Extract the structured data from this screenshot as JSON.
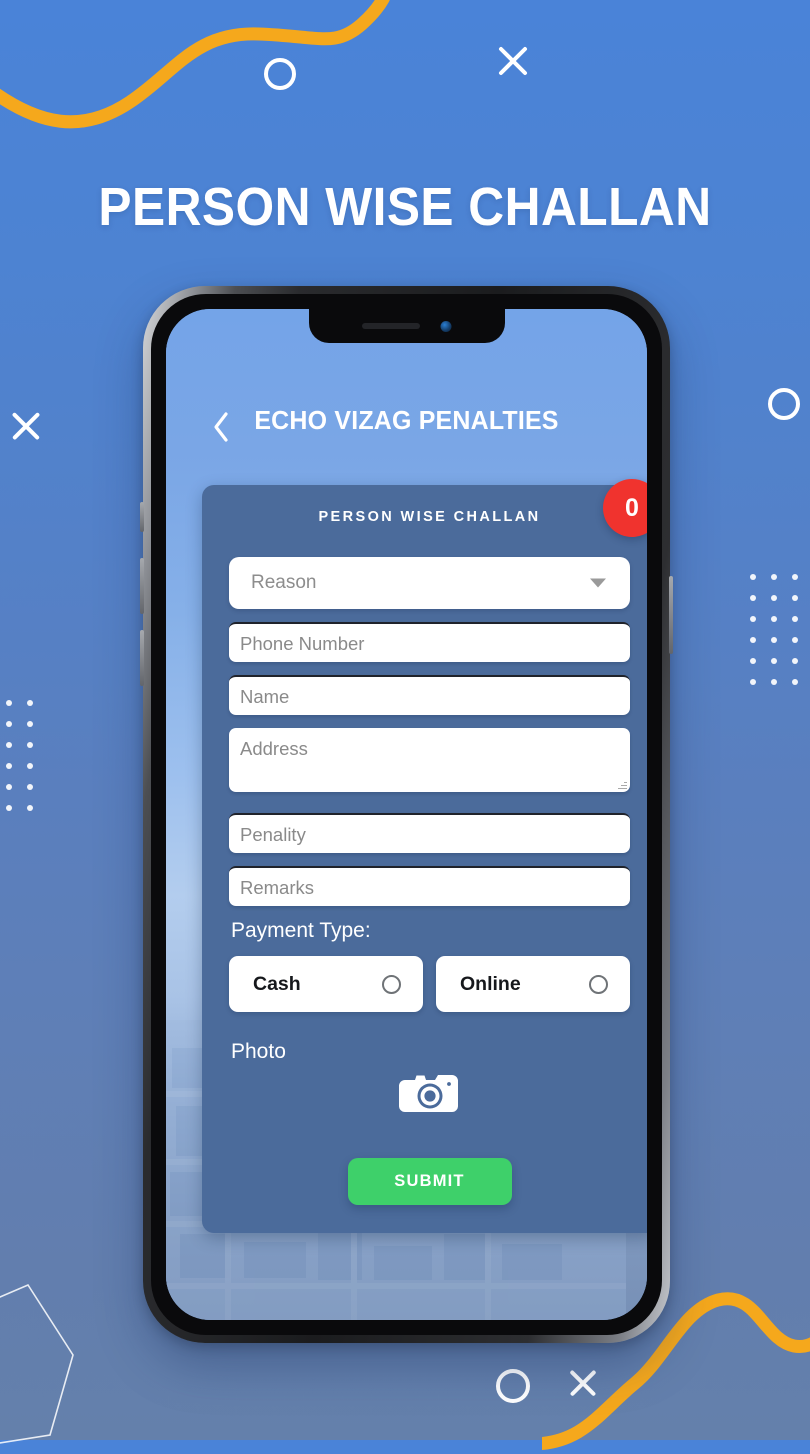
{
  "page": {
    "headline": "PERSON WISE CHALLAN",
    "background_color": "#4a83d8",
    "accent_yellow": "#f5a81c",
    "accent_green": "#3ed06a",
    "accent_red": "#f0332e"
  },
  "decorations": {
    "top_x": "x-mark",
    "left_x": "x-mark",
    "right_ring": "circle-outline",
    "top_ring": "circle-outline",
    "bottom_ring": "circle-outline",
    "bottom_x": "x-mark",
    "wave_top": "yellow-wave",
    "wave_bottom": "yellow-wave",
    "dot_grid_left": "dot-grid",
    "dot_grid_right": "dot-grid",
    "polygon_bottom_left": "polygon-outline"
  },
  "phone": {
    "appbar": {
      "back_icon": "chevron-left-icon",
      "title": "ECHO VIZAG PENALTIES"
    },
    "card": {
      "title": "PERSON WISE CHALLAN",
      "badge_count": "0",
      "fields": {
        "reason": {
          "placeholder": "Reason",
          "value": "",
          "type": "select",
          "caret": "chevron-down-icon"
        },
        "phone": {
          "placeholder": "Phone Number",
          "value": "",
          "type": "text"
        },
        "name": {
          "placeholder": "Name",
          "value": "",
          "type": "text"
        },
        "address": {
          "placeholder": "Address",
          "value": "",
          "type": "textarea"
        },
        "penality": {
          "placeholder": "Penality",
          "value": "",
          "type": "text"
        },
        "remarks": {
          "placeholder": "Remarks",
          "value": "",
          "type": "text"
        }
      },
      "payment": {
        "label": "Payment Type:",
        "options": [
          {
            "label": "Cash",
            "selected": false
          },
          {
            "label": "Online",
            "selected": false
          }
        ]
      },
      "photo": {
        "label": "Photo",
        "icon": "camera-icon"
      },
      "submit_label": "SUBMIT"
    }
  }
}
